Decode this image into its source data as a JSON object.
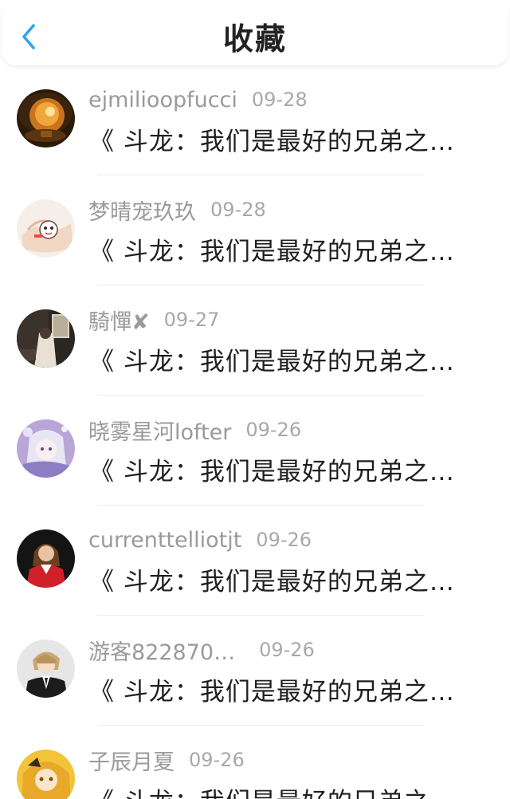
{
  "header": {
    "title": "收藏",
    "back_icon": "chevron-left-icon",
    "accent_color": "#2aa5ee"
  },
  "items": [
    {
      "user": "ejmilioopfucci",
      "date": "09-28",
      "title": "《 斗龙：我们是最好的兄弟之…",
      "avatar": "glass-sphere-avatar"
    },
    {
      "user": "梦晴宠玖玖",
      "date": "09-28",
      "title": "《 斗龙：我们是最好的兄弟之…",
      "avatar": "hand-doodle-avatar"
    },
    {
      "user": "騎憚✘",
      "date": "09-27",
      "title": "《 斗龙：我们是最好的兄弟之…",
      "avatar": "dark-room-avatar"
    },
    {
      "user": "晓雾星河lofter",
      "date": "09-26",
      "title": "《 斗龙：我们是最好的兄弟之…",
      "avatar": "anime-girl-purple-avatar"
    },
    {
      "user": "currenttelliotjt",
      "date": "09-26",
      "title": "《 斗龙：我们是最好的兄弟之…",
      "avatar": "woman-red-coat-avatar"
    },
    {
      "user": "游客822870…",
      "date": "09-26",
      "title": "《 斗龙：我们是最好的兄弟之…",
      "avatar": "anime-boy-suit-avatar"
    },
    {
      "user": "子辰月夏",
      "date": "09-26",
      "title": "《 斗龙：我们是最好的兄弟之…",
      "avatar": "anime-girl-yellow-avatar"
    }
  ]
}
